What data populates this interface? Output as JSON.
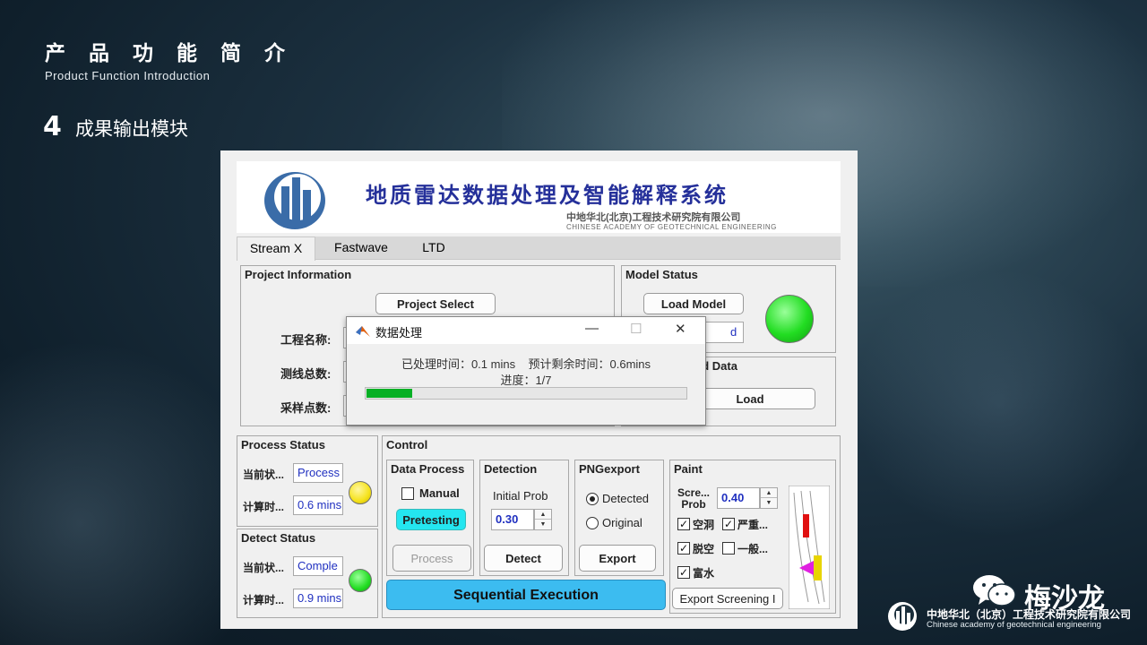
{
  "slide": {
    "title": "产 品 功 能 简 介",
    "subtitle": "Product Function Introduction",
    "section_number": "4",
    "section_title": "成果输出模块"
  },
  "banner": {
    "title_cn": "地质雷达数据处理及智能解释系统",
    "org_cn": "中地华北(北京)工程技术研究院有限公司",
    "org_en": "CHINESE ACADEMY OF GEOTECHNICAL ENGINEERING"
  },
  "tabs": [
    "Stream X",
    "Fastwave",
    "LTD"
  ],
  "project_info": {
    "title": "Project Information",
    "select_button": "Project Select",
    "name_label": "工程名称:",
    "lines_label": "测线总数:",
    "samples_label": "采样点数:"
  },
  "model_status": {
    "title": "Model Status",
    "load_button": "Load Model",
    "status_value": "d",
    "lamp_color": "#22dd22"
  },
  "loaded_data": {
    "title_partial": "ed Data",
    "load_button": "Load"
  },
  "dialog": {
    "title": "数据处理",
    "minimize": "—",
    "maximize": "☐",
    "close": "✕",
    "time_line": "已处理时间：0.1 mins    预计剩余时间：0.6mins",
    "progress_line": "进度：1/7",
    "progress": 0.143
  },
  "process_status": {
    "title": "Process Status",
    "state_label": "当前状...",
    "state_value": "Process",
    "time_label": "计算时...",
    "time_value": "0.6 mins",
    "lamp_color": "#f5e21a"
  },
  "detect_status": {
    "title": "Detect Status",
    "state_label": "当前状...",
    "state_value": "Comple",
    "time_label": "计算时...",
    "time_value": "0.9 mins",
    "lamp_color": "#22dd22"
  },
  "control": {
    "title": "Control",
    "data_process": {
      "title": "Data Process",
      "manual_label": "Manual",
      "manual_checked": false,
      "pretesting_button": "Pretesting",
      "process_button": "Process"
    },
    "detection": {
      "title": "Detection",
      "initial_prob_label": "Initial Prob",
      "initial_prob_value": "0.30",
      "detect_button": "Detect"
    },
    "pngexport": {
      "title": "PNGexport",
      "detected_label": "Detected",
      "original_label": "Original",
      "selected": "Detected",
      "export_button": "Export"
    },
    "paint": {
      "title": "Paint",
      "screen_label": "Scre... Prob",
      "screen_value": "0.40",
      "cb1": "空洞",
      "cb2": "严重...",
      "cb3": "脱空",
      "cb4": "一般...",
      "cb5": "富水",
      "export_screening_button": "Export Screening I"
    },
    "sequential_button": "Sequential Execution"
  },
  "watermark": {
    "wechat_name": "梅沙龙",
    "company_cn": "中地华北（北京）工程技术研究院有限公司",
    "company_en": "Chinese academy of geotechnical engineering"
  }
}
